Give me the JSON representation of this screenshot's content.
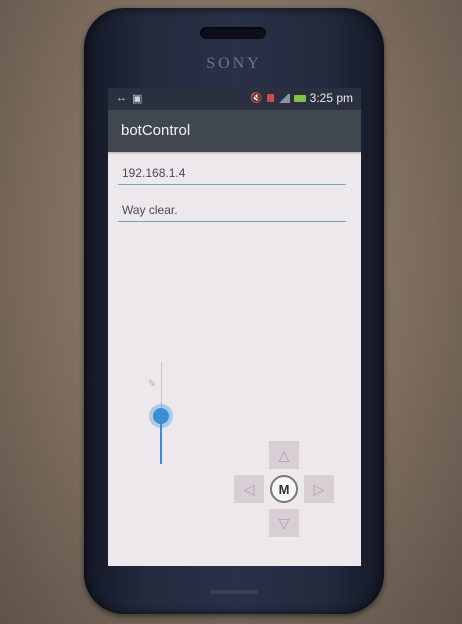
{
  "phone": {
    "brand": "SONY"
  },
  "statusbar": {
    "left_icons": [
      "usb-icon",
      "camera-icon"
    ],
    "right_icons": [
      "mute-icon",
      "notification-icon",
      "signal-icon",
      "battery-icon"
    ],
    "time": "3:25 pm"
  },
  "app": {
    "title": "botControl",
    "ip_field": {
      "value": "192.168.1.4"
    },
    "status_field": {
      "value": "Way clear."
    },
    "speed_slider": {
      "icon": "pencil-icon"
    },
    "dpad": {
      "up_icon": "arrow-up-icon",
      "down_icon": "arrow-down-icon",
      "left_icon": "arrow-left-icon",
      "right_icon": "arrow-right-icon",
      "center_icon": "m-logo-icon",
      "center_label": "M"
    }
  },
  "colors": {
    "statusbar": "#2b3040",
    "titlebar": "#41474f",
    "screen_bg": "#ede8ec",
    "accent": "#3a8ed6"
  }
}
